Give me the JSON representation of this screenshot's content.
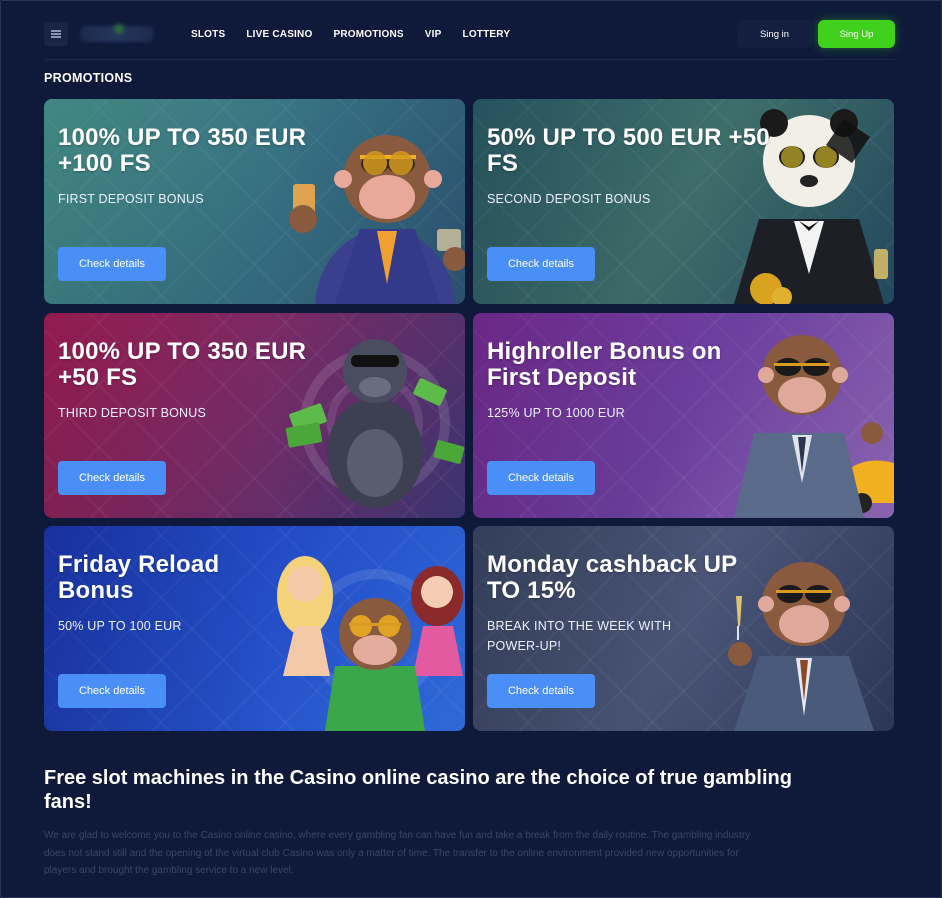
{
  "header": {
    "nav": [
      "SLOTS",
      "LIVE CASINO",
      "PROMOTIONS",
      "VIP",
      "LOTTERY"
    ],
    "signin_label": "Sing in",
    "signup_label": "Sing Up"
  },
  "section_title": "PROMOTIONS",
  "promos": [
    {
      "title": "100% UP TO 350 EUR +100 FS",
      "subtitle": "FIRST DEPOSIT BONUS",
      "cta": "Check details",
      "color_from": "#3f8f8a",
      "color_to": "#2a4f6e",
      "character": "monkey-with-drinks"
    },
    {
      "title": "50% UP TO 500 EUR +50 FS",
      "subtitle": "SECOND DEPOSIT BONUS",
      "cta": "Check details",
      "color_from": "#2d6b73",
      "color_to": "#1f4860",
      "character": "panda-in-tuxedo"
    },
    {
      "title": "100% UP TO 350 EUR +50 FS",
      "subtitle": "THIRD DEPOSIT BONUS",
      "cta": "Check details",
      "color_from": "#a21f5c",
      "color_to": "#3b2f6a",
      "character": "gorilla-with-money"
    },
    {
      "title": "Highroller Bonus on First Deposit",
      "subtitle": "125% UP TO 1000 EUR",
      "cta": "Check details",
      "color_from": "#7e2f9a",
      "color_to": "#8a5bb0",
      "character": "monkey-with-car"
    },
    {
      "title": "Friday Reload Bonus",
      "subtitle": "50% UP TO 100 EUR",
      "cta": "Check details",
      "color_from": "#1c3eb8",
      "color_to": "#2b5bd1",
      "character": "monkey-with-girls"
    },
    {
      "title": "Monday cashback UP TO 15%",
      "subtitle": "BREAK INTO THE WEEK WITH POWER-UP!",
      "cta": "Check details",
      "color_from": "#3d4a6c",
      "color_to": "#2a3553",
      "character": "monkey-with-champagne"
    }
  ],
  "seo": {
    "title": "Free slot machines in the Casino online casino are the choice of true gambling fans!",
    "text": "We are glad to welcome you to the Casino online casino, where every gambling fan can have fun and take a break from the daily routine. The gambling industry does not stand still and the opening of the virtual club Casino was only a matter of time. The transfer to the online environment provided new opportunities for players and brought the gambling service to a new level."
  }
}
